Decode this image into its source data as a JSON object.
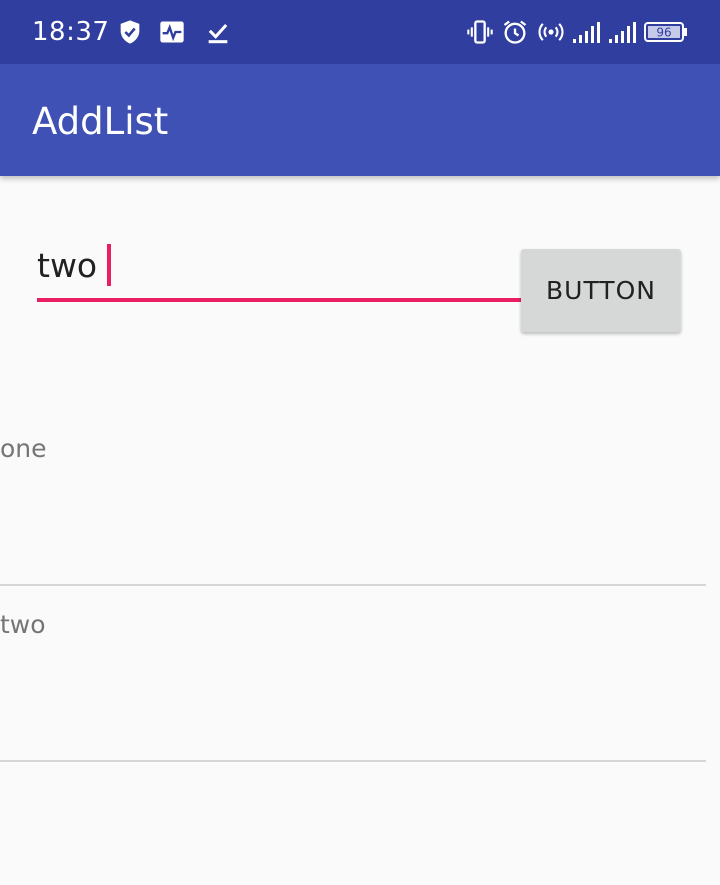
{
  "status_bar": {
    "time": "18:37",
    "battery_level": "96",
    "left_icons": [
      "shield-check-icon",
      "activity-monitor-icon",
      "download-done-icon"
    ],
    "right_icons": [
      "vibrate-icon",
      "alarm-icon",
      "hotspot-icon",
      "signal-icon",
      "signal-icon",
      "battery-icon"
    ],
    "background_color": "#303f9f"
  },
  "app_bar": {
    "title": "AddList",
    "background_color": "#3f51b5"
  },
  "form": {
    "input_value": "two",
    "accent_color": "#e91e63",
    "button_label": "BUTTON"
  },
  "list": {
    "items": [
      {
        "label": "one"
      },
      {
        "label": "two"
      }
    ]
  }
}
